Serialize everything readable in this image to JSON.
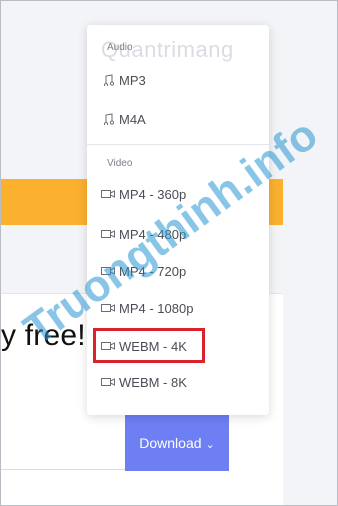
{
  "page": {
    "free_text": "y free!",
    "download_label": "Download",
    "chevron": "⌄"
  },
  "dropdown": {
    "audio_label": "Audio",
    "video_label": "Video",
    "audio_items": [
      {
        "label": "MP3",
        "icon": "music-note-icon"
      },
      {
        "label": "M4A",
        "icon": "music-note-icon"
      }
    ],
    "video_items": [
      {
        "label": "MP4 - 360p",
        "icon": "video-camera-icon"
      },
      {
        "label": "MP4 - 480p",
        "icon": "video-camera-icon"
      },
      {
        "label": "MP4 - 720p",
        "icon": "video-camera-icon"
      },
      {
        "label": "MP4 - 1080p",
        "icon": "video-camera-icon"
      },
      {
        "label": "WEBM - 4K",
        "icon": "video-camera-icon"
      },
      {
        "label": "WEBM - 8K",
        "icon": "video-camera-icon"
      }
    ],
    "highlighted_item": "WEBM - 4K"
  },
  "watermarks": {
    "logo_text": "Quantrimang",
    "diagonal_text": "Truongthinh.info"
  },
  "colors": {
    "accent": "#6e7ff3",
    "orange": "#fbb02e",
    "highlight": "#d9222a"
  }
}
